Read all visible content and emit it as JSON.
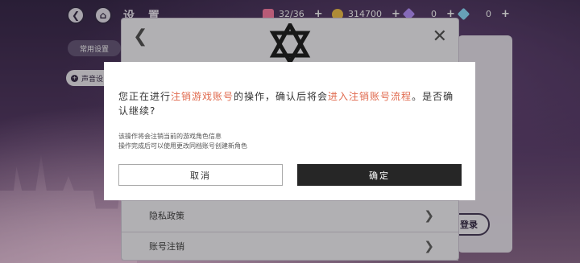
{
  "header": {
    "title": "设 置",
    "stamina": "32/36",
    "gold": "314700",
    "gem_a": "0",
    "gem_b": "0"
  },
  "tabs": {
    "common": "常用设置",
    "sound": "声音设"
  },
  "settings": {
    "row_privacy": "隐私政策",
    "row_account": "账号注销",
    "login_label": "登录"
  },
  "modal": {
    "msg_prefix": "您正在进行",
    "msg_highlight_1": "注销游戏账号",
    "msg_middle": "的操作，确认后将会",
    "msg_highlight_2": "进入注销账号流程",
    "msg_suffix": "。是否确认继续?",
    "note_line_1": "该操作将会注销当前的游戏角色信息",
    "note_line_2": "操作完成后可以使用更改同档账号创建新角色",
    "cancel_label": "取消",
    "confirm_label": "确定"
  },
  "icons": {
    "back": "back-arrow-icon",
    "home": "home-icon",
    "stamina": "stamina-icon",
    "gold": "coin-icon",
    "gem_a": "diamond-icon",
    "gem_b": "crystal-icon"
  }
}
